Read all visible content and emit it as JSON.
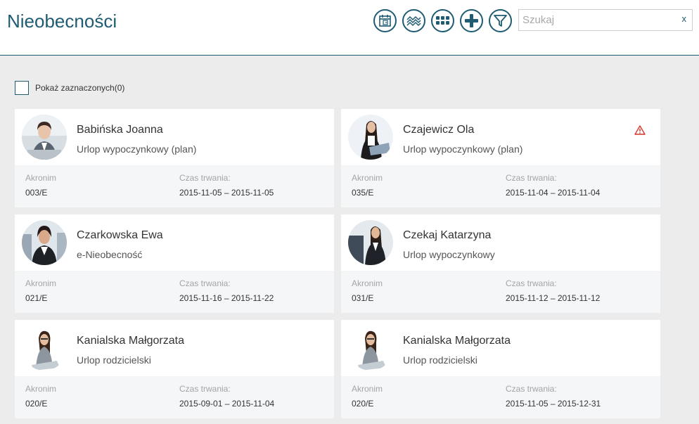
{
  "header": {
    "title": "Nieobecności",
    "toolbar": [
      {
        "name": "calendar-button",
        "icon": "calendar-icon"
      },
      {
        "name": "trend-button",
        "icon": "trend-lines-icon"
      },
      {
        "name": "grid-view-button",
        "icon": "grid-icon"
      },
      {
        "name": "add-button",
        "icon": "plus-icon"
      },
      {
        "name": "filter-button",
        "icon": "filter-icon"
      }
    ],
    "search": {
      "placeholder": "Szukaj",
      "value": "",
      "clear": "x"
    }
  },
  "show_selected": {
    "label": "Pokaż zaznaczonych(0)",
    "checked": false
  },
  "field_labels": {
    "acronym": "Akronim",
    "duration": "Czas trwania:"
  },
  "cards": [
    {
      "name": "Babińska Joanna",
      "type": "Urlop wypoczynkowy (plan)",
      "acronym": "003/E",
      "duration": "2015-11-05 – 2015-11-05",
      "warning": false
    },
    {
      "name": "Czajewicz Ola",
      "type": "Urlop wypoczynkowy (plan)",
      "acronym": "035/E",
      "duration": "2015-11-04 – 2015-11-04",
      "warning": true
    },
    {
      "name": "Czarkowska Ewa",
      "type": "e-Nieobecność",
      "acronym": "021/E",
      "duration": "2015-11-16 – 2015-11-22",
      "warning": false
    },
    {
      "name": "Czekaj Katarzyna",
      "type": "Urlop wypoczynkowy",
      "acronym": "031/E",
      "duration": "2015-11-12 – 2015-11-12",
      "warning": false
    },
    {
      "name": "Kanialska Małgorzata",
      "type": "Urlop rodzicielski",
      "acronym": "020/E",
      "duration": "2015-09-01 – 2015-11-04",
      "warning": false
    },
    {
      "name": "Kanialska Małgorzata",
      "type": "Urlop rodzicielski",
      "acronym": "020/E",
      "duration": "2015-11-05 – 2015-12-31",
      "warning": false
    }
  ],
  "colors": {
    "accent": "#1f5b73",
    "warning": "#d9342b",
    "card_footer": "#f4f6f8",
    "background": "#ececec"
  }
}
